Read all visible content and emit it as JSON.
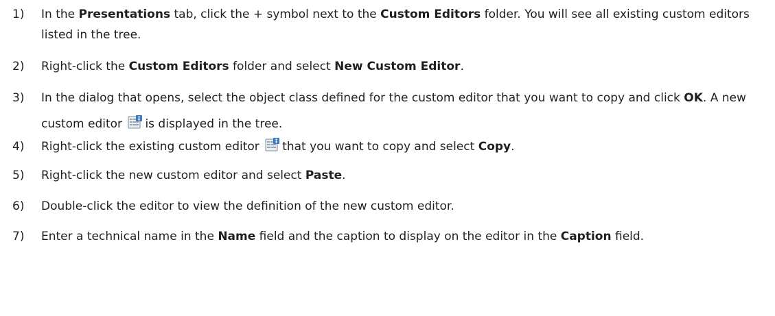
{
  "steps": [
    {
      "num": "1)",
      "parts": [
        "In the ",
        "Presentations",
        " tab, click the + symbol next to the ",
        "Custom Editors",
        " folder. You will see all existing custom editors listed in the tree."
      ]
    },
    {
      "num": "2)",
      "parts": [
        "Right-click the ",
        "Custom Editors",
        " folder and select ",
        "New Custom Editor",
        "."
      ]
    },
    {
      "num": "3)",
      "parts": [
        "In the dialog that opens, select the object class defined for the custom editor that you want to copy and click ",
        "OK",
        ". A new custom editor ",
        "is displayed in the tree."
      ]
    },
    {
      "num": "4)",
      "parts": [
        "Right-click the existing custom editor ",
        "that you want to copy and select ",
        "Copy",
        "."
      ]
    },
    {
      "num": "5)",
      "parts": [
        "Right-click the new custom editor and select ",
        "Paste",
        "."
      ]
    },
    {
      "num": "6)",
      "parts": [
        "Double-click the editor to view the definition of the new custom editor."
      ]
    },
    {
      "num": "7)",
      "parts": [
        "Enter a technical name in the ",
        "Name",
        " field and the caption to display on the editor in the ",
        "Caption",
        " field."
      ]
    }
  ],
  "icons": {
    "custom_editor": "custom-editor-icon",
    "color_blue": "#3b78c4",
    "color_gray": "#9aa4ad"
  }
}
